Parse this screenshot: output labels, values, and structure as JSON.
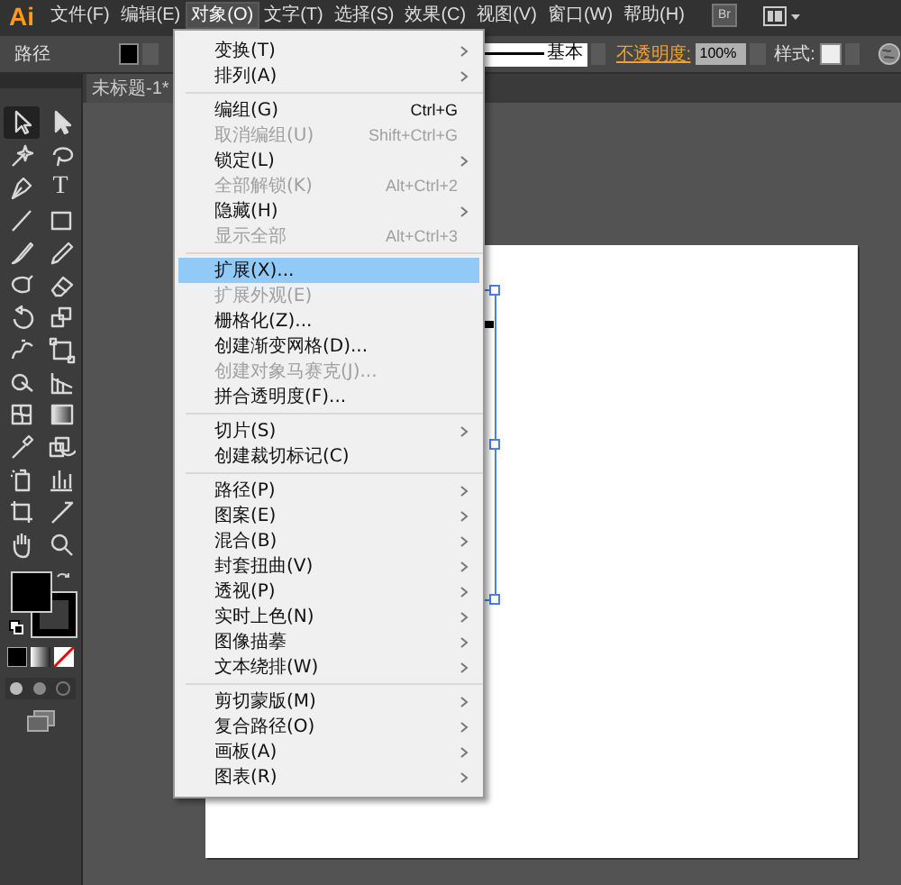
{
  "app_logo": "Ai",
  "menubar": [
    {
      "label": "文件(F)",
      "selected": false
    },
    {
      "label": "编辑(E)",
      "selected": false
    },
    {
      "label": "对象(O)",
      "selected": true
    },
    {
      "label": "文字(T)",
      "selected": false
    },
    {
      "label": "选择(S)",
      "selected": false
    },
    {
      "label": "效果(C)",
      "selected": false
    },
    {
      "label": "视图(V)",
      "selected": false
    },
    {
      "label": "窗口(W)",
      "selected": false
    },
    {
      "label": "帮助(H)",
      "selected": false
    }
  ],
  "bridge_button": "Br",
  "control_bar": {
    "object_type": "路径",
    "stroke_style": "基本",
    "opacity_label": "不透明度:",
    "opacity": "100%",
    "style_label": "样式:"
  },
  "document_tab": {
    "title": "未标题-1*"
  },
  "tools": [
    {
      "kind": "selection",
      "selected": true
    },
    {
      "kind": "direct-selection",
      "selected": false
    },
    {
      "kind": "magic-wand",
      "selected": false
    },
    {
      "kind": "lasso",
      "selected": false
    },
    {
      "kind": "pen",
      "selected": false
    },
    {
      "kind": "type",
      "glyph": "T",
      "selected": false
    },
    {
      "kind": "line",
      "selected": false
    },
    {
      "kind": "rectangle",
      "selected": false
    },
    {
      "kind": "paintbrush",
      "selected": false
    },
    {
      "kind": "pencil",
      "selected": false
    },
    {
      "kind": "blob-brush",
      "selected": false
    },
    {
      "kind": "eraser",
      "selected": false
    },
    {
      "kind": "rotate",
      "selected": false
    },
    {
      "kind": "scale",
      "selected": false
    },
    {
      "kind": "warp",
      "selected": false
    },
    {
      "kind": "free-transform",
      "selected": false
    },
    {
      "kind": "shape-builder",
      "selected": false
    },
    {
      "kind": "perspective-grid",
      "selected": false
    },
    {
      "kind": "mesh",
      "selected": false
    },
    {
      "kind": "gradient",
      "selected": false
    },
    {
      "kind": "eyedropper",
      "selected": false
    },
    {
      "kind": "blend",
      "selected": false
    },
    {
      "kind": "symbol-sprayer",
      "selected": false
    },
    {
      "kind": "graph",
      "selected": false
    },
    {
      "kind": "artboard",
      "selected": false
    },
    {
      "kind": "slice",
      "selected": false
    },
    {
      "kind": "hand",
      "selected": false
    },
    {
      "kind": "zoom",
      "selected": false
    }
  ],
  "object_menu": [
    {
      "kind": "item",
      "label": "变换(T)",
      "submenu": true,
      "disabled": false,
      "selected": false
    },
    {
      "kind": "item",
      "label": "排列(A)",
      "submenu": true,
      "disabled": false,
      "selected": false
    },
    {
      "kind": "separator"
    },
    {
      "kind": "item",
      "label": "编组(G)",
      "shortcut": "Ctrl+G",
      "submenu": false,
      "disabled": false,
      "selected": false
    },
    {
      "kind": "item",
      "label": "取消编组(U)",
      "shortcut": "Shift+Ctrl+G",
      "submenu": false,
      "disabled": true,
      "selected": false
    },
    {
      "kind": "item",
      "label": "锁定(L)",
      "submenu": true,
      "disabled": false,
      "selected": false
    },
    {
      "kind": "item",
      "label": "全部解锁(K)",
      "shortcut": "Alt+Ctrl+2",
      "submenu": false,
      "disabled": true,
      "selected": false
    },
    {
      "kind": "item",
      "label": "隐藏(H)",
      "submenu": true,
      "disabled": false,
      "selected": false
    },
    {
      "kind": "item",
      "label": "显示全部",
      "shortcut": "Alt+Ctrl+3",
      "submenu": false,
      "disabled": true,
      "selected": false
    },
    {
      "kind": "separator"
    },
    {
      "kind": "item",
      "label": "扩展(X)...",
      "submenu": false,
      "disabled": false,
      "selected": true
    },
    {
      "kind": "item",
      "label": "扩展外观(E)",
      "submenu": false,
      "disabled": true,
      "selected": false
    },
    {
      "kind": "item",
      "label": "栅格化(Z)...",
      "submenu": false,
      "disabled": false,
      "selected": false
    },
    {
      "kind": "item",
      "label": "创建渐变网格(D)...",
      "submenu": false,
      "disabled": false,
      "selected": false
    },
    {
      "kind": "item",
      "label": "创建对象马赛克(J)...",
      "submenu": false,
      "disabled": true,
      "selected": false
    },
    {
      "kind": "item",
      "label": "拼合透明度(F)...",
      "submenu": false,
      "disabled": false,
      "selected": false
    },
    {
      "kind": "separator"
    },
    {
      "kind": "item",
      "label": "切片(S)",
      "submenu": true,
      "disabled": false,
      "selected": false
    },
    {
      "kind": "item",
      "label": "创建裁切标记(C)",
      "submenu": false,
      "disabled": false,
      "selected": false
    },
    {
      "kind": "separator"
    },
    {
      "kind": "item",
      "label": "路径(P)",
      "submenu": true,
      "disabled": false,
      "selected": false
    },
    {
      "kind": "item",
      "label": "图案(E)",
      "submenu": true,
      "disabled": false,
      "selected": false
    },
    {
      "kind": "item",
      "label": "混合(B)",
      "submenu": true,
      "disabled": false,
      "selected": false
    },
    {
      "kind": "item",
      "label": "封套扭曲(V)",
      "submenu": true,
      "disabled": false,
      "selected": false
    },
    {
      "kind": "item",
      "label": "透视(P)",
      "submenu": true,
      "disabled": false,
      "selected": false
    },
    {
      "kind": "item",
      "label": "实时上色(N)",
      "submenu": true,
      "disabled": false,
      "selected": false
    },
    {
      "kind": "item",
      "label": "图像描摹",
      "submenu": true,
      "disabled": false,
      "selected": false
    },
    {
      "kind": "item",
      "label": "文本绕排(W)",
      "submenu": true,
      "disabled": false,
      "selected": false
    },
    {
      "kind": "separator"
    },
    {
      "kind": "item",
      "label": "剪切蒙版(M)",
      "submenu": true,
      "disabled": false,
      "selected": false
    },
    {
      "kind": "item",
      "label": "复合路径(O)",
      "submenu": true,
      "disabled": false,
      "selected": false
    },
    {
      "kind": "item",
      "label": "画板(A)",
      "submenu": true,
      "disabled": false,
      "selected": false
    },
    {
      "kind": "item",
      "label": "图表(R)",
      "submenu": true,
      "disabled": false,
      "selected": false
    }
  ]
}
